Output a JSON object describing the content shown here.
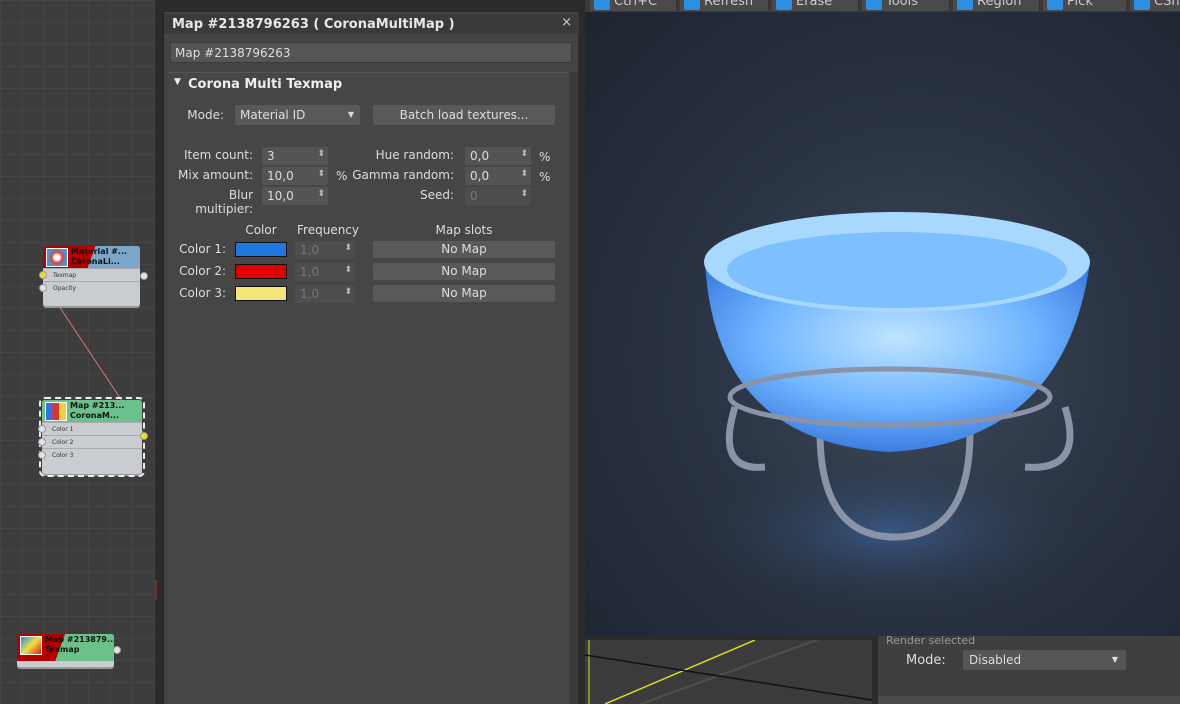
{
  "node_editor": {
    "nodes": [
      {
        "title": "Material #...",
        "subtitle": "CoronaLi...",
        "ports": [
          "Texmap",
          "Opacity"
        ]
      },
      {
        "title": "Map #213...",
        "subtitle": "CoronaM...",
        "ports": [
          "Color 1",
          "Color 2",
          "Color 3"
        ]
      },
      {
        "title": "Map #213879...",
        "subtitle": "Texmap",
        "ports": []
      }
    ]
  },
  "panel": {
    "title": "Map #2138796263  ( CoronaMultiMap )",
    "close": "×",
    "name_value": "Map #2138796263",
    "rollout": "Corona Multi Texmap",
    "mode_label": "Mode:",
    "mode_value": "Material ID",
    "batch_button": "Batch load textures...",
    "item_count_label": "Item count:",
    "item_count": "3",
    "mix_amount_label": "Mix amount:",
    "mix_amount": "10,0",
    "blur_label": "Blur multipier:",
    "blur": "10,0",
    "hue_label": "Hue random:",
    "hue": "0,0",
    "gamma_label": "Gamma random:",
    "gamma": "0,0",
    "seed_label": "Seed:",
    "seed": "0",
    "percent": "%",
    "col_color": "Color",
    "col_frequency": "Frequency",
    "col_map": "Map slots",
    "rows": [
      {
        "label": "Color 1:",
        "color": "#1f78e0",
        "frequency": "1,0",
        "map": "No Map"
      },
      {
        "label": "Color 2:",
        "color": "#e00000",
        "frequency": "1,0",
        "map": "No Map"
      },
      {
        "label": "Color 3:",
        "color": "#f3e57a",
        "frequency": "1,0",
        "map": "No Map"
      }
    ]
  },
  "toolbar": [
    "Ctrl+C",
    "Refresh",
    "Erase",
    "Tools",
    "Region",
    "Pick",
    "CShad"
  ],
  "render_panel": {
    "section": "Render selected",
    "mode_label": "Mode:",
    "mode_value": "Disabled"
  }
}
